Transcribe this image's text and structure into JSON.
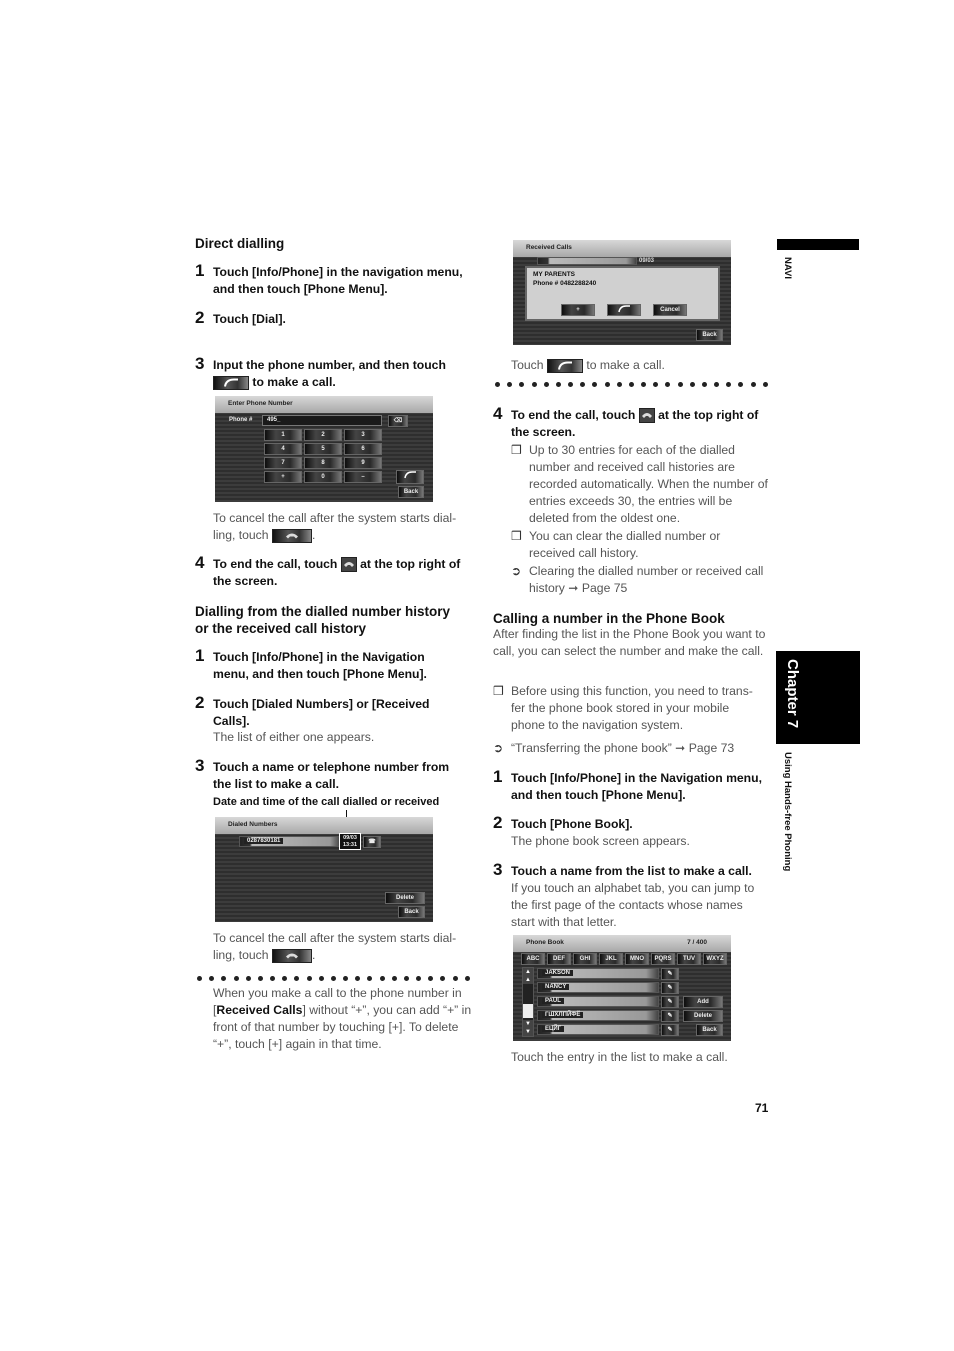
{
  "side": {
    "navi_label": "NAVI",
    "chapter_label": "Chapter 7",
    "section_label": "Using Hands-free Phoning"
  },
  "page_number": "71",
  "left": {
    "direct": {
      "heading": "Direct dialling",
      "steps": [
        {
          "num": "1",
          "text": "Touch [Info/Phone] in the navigation menu, and then touch [Phone Menu]."
        },
        {
          "num": "2",
          "text": "Touch [Dial]."
        },
        {
          "num": "3",
          "text_before_icon": "Input the phone number, and then touch",
          "text_after_icon": "to make a call."
        },
        {
          "num": "4",
          "text_before_icon": "To end the call, touch",
          "text_after_icon": "at the top right of the screen."
        }
      ],
      "cancel_note_before": "To cancel the call after the system starts dial-ling, touch",
      "cancel_note_after": ".",
      "screen": {
        "title": "Enter Phone Number",
        "phone_label": "Phone #",
        "phone_value": "495_",
        "keys": [
          "1",
          "2",
          "3",
          "4",
          "5",
          "6",
          "7",
          "8",
          "9",
          "+",
          "0",
          "–"
        ],
        "back_label": "Back",
        "delete_icon": "backspace-icon",
        "call_icon": "phone-handset-icon"
      }
    },
    "history": {
      "heading": "Dialling from the dialled number history or the received call history",
      "steps": [
        {
          "num": "1",
          "text": "Touch [Info/Phone] in the Navigation menu, and then touch [Phone Menu]."
        },
        {
          "num": "2",
          "text": "Touch [Dialed Numbers] or [Received Calls].",
          "sub": "The list of either one appears."
        },
        {
          "num": "3",
          "text": "Touch a name or telephone number from the list to make a call."
        }
      ],
      "callout": "Date and time of the call dialled or received",
      "screen": {
        "title": "Dialed Numbers",
        "entry_number": "0287830181",
        "entry_date": "09/03",
        "entry_time": "13:31",
        "delete_label": "Delete",
        "back_label": "Back"
      },
      "cancel_note_before": "To cancel the call after the system starts dial-ling, touch",
      "cancel_note_after": ".",
      "plus_note": {
        "p1": "When you make a call to the phone number in [",
        "bold": "Received Calls",
        "p2": "] without “+”, you can add “+” in front of that number by touching [+]. To delete “+”, touch [+] again in that time."
      }
    }
  },
  "right": {
    "received_screen": {
      "title": "Received Calls",
      "row_name_partial": "MY PARENTS",
      "row_date": "09/03",
      "popup_name": "MY PARENTS",
      "popup_phone": "Phone # 0482288240",
      "plus_label": "+",
      "cancel_label": "Cancel",
      "back_label": "Back"
    },
    "touch_call_before": "Touch",
    "touch_call_after": "to make a call.",
    "step4": {
      "num": "4",
      "text_before_icon": "To end the call, touch",
      "text_after_icon": "at the top right of the screen."
    },
    "notes": [
      {
        "mark": "❒",
        "text": "Up to 30 entries for each of the dialled number and received call histories are recorded automatically. When the number of entries exceeds 30, the entries will be deleted from the oldest one."
      },
      {
        "mark": "❒",
        "text": "You can clear the dialled number or received call history."
      },
      {
        "mark": "➲",
        "text": "Clearing the dialled number or received call history ➞ Page 75"
      }
    ],
    "phonebook": {
      "heading": "Calling a number in the Phone Book",
      "intro": "After finding the list in the Phone Book you want to call, you can select the number and make the call.",
      "notes": [
        {
          "mark": "❒",
          "text": "Before using this function, you need to trans-fer the phone book stored in your mobile phone to the navigation system."
        },
        {
          "mark": "➲",
          "text": "“Transferring the phone book” ➞ Page 73"
        }
      ],
      "steps": [
        {
          "num": "1",
          "text": "Touch [Info/Phone] in the Navigation menu, and then touch [Phone Menu]."
        },
        {
          "num": "2",
          "text": "Touch [Phone Book].",
          "sub": "The phone book screen appears."
        },
        {
          "num": "3",
          "text": "Touch a name from the list to make a call.",
          "sub": "If you touch an alphabet tab, you can jump to the first page of the contacts whose names start with that letter."
        }
      ],
      "screen": {
        "title": "Phone Book",
        "count": "7 / 400",
        "tabs": [
          "ABC",
          "DEF",
          "GHI",
          "JKL",
          "MNO",
          "PQRS",
          "TUV",
          "WXYZ"
        ],
        "entries": [
          "JAKSON",
          "NANCY",
          "PAUL",
          "ГШХЛПЙФЁ",
          "ЕЦЙГ"
        ],
        "add_label": "Add",
        "delete_label": "Delete",
        "back_label": "Back"
      },
      "caption": "Touch the entry in the list to make a call."
    }
  }
}
